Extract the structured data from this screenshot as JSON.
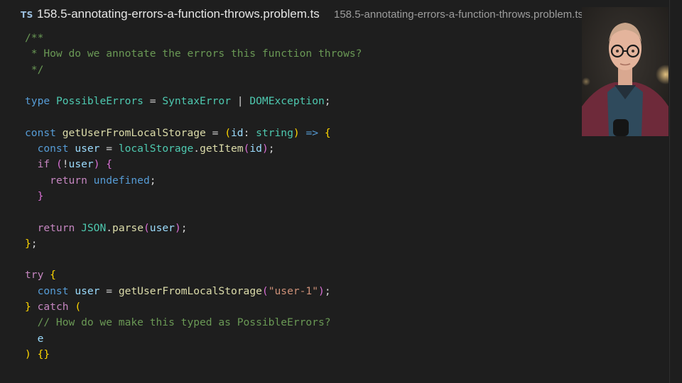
{
  "tab": {
    "language_badge": "TS",
    "file_name": "158.5-annotating-errors-a-function-throws.problem.ts",
    "file_path": "158.5-annotating-errors-a-function-throws.problem.ts"
  },
  "code": {
    "l1_comment": "/**",
    "l2_comment": " * How do we annotate the errors this function throws?",
    "l3_comment": " */",
    "l5_type_kw": "type",
    "l5_type_name": "PossibleErrors",
    "l5_eq": " = ",
    "l5_t1": "SyntaxError",
    "l5_pipe": " | ",
    "l5_t2": "DOMException",
    "l5_semi": ";",
    "l7_const": "const",
    "l7_fn": "getUserFromLocalStorage",
    "l7_eq": " = ",
    "l7_paren_open": "(",
    "l7_param": "id",
    "l7_colon": ": ",
    "l7_param_type": "string",
    "l7_paren_close": ")",
    "l7_arrow": " => ",
    "l7_brace": "{",
    "l8_indent": "  ",
    "l8_const": "const",
    "l8_var": "user",
    "l8_eq": " = ",
    "l8_obj": "localStorage",
    "l8_dot": ".",
    "l8_method": "getItem",
    "l8_po": "(",
    "l8_arg": "id",
    "l8_pc": ")",
    "l8_semi": ";",
    "l9_indent": "  ",
    "l9_if": "if",
    "l9_po": "(",
    "l9_not": "!",
    "l9_var": "user",
    "l9_pc": ")",
    "l9_brace": "{",
    "l10_indent": "    ",
    "l10_return": "return",
    "l10_undef": "undefined",
    "l10_semi": ";",
    "l11_indent": "  ",
    "l11_brace": "}",
    "l13_indent": "  ",
    "l13_return": "return",
    "l13_json": "JSON",
    "l13_dot": ".",
    "l13_parse": "parse",
    "l13_po": "(",
    "l13_arg": "user",
    "l13_pc": ")",
    "l13_semi": ";",
    "l14_brace": "}",
    "l14_semi": ";",
    "l16_try": "try",
    "l16_brace": "{",
    "l17_indent": "  ",
    "l17_const": "const",
    "l17_var": "user",
    "l17_eq": " = ",
    "l17_fn": "getUserFromLocalStorage",
    "l17_po": "(",
    "l17_str": "\"user-1\"",
    "l17_pc": ")",
    "l17_semi": ";",
    "l18_brace": "}",
    "l18_catch": "catch",
    "l18_po": "(",
    "l19_comment": "  // How do we make this typed as PossibleErrors?",
    "l20_indent": "  ",
    "l20_var": "e",
    "l21_pc": ")",
    "l21_braces": "{}"
  },
  "colors": {
    "background": "#1e1e1e",
    "comment": "#6a9955",
    "keyword": "#569cd6",
    "control_keyword": "#c586c0",
    "type": "#4ec9b0",
    "variable": "#9cdcfe",
    "function": "#dcdcaa",
    "string": "#ce9178",
    "bracket_gold": "#ffd700",
    "bracket_purple": "#da70d6"
  },
  "icons": {
    "language": "typescript-icon",
    "webcam": "presenter-webcam"
  }
}
